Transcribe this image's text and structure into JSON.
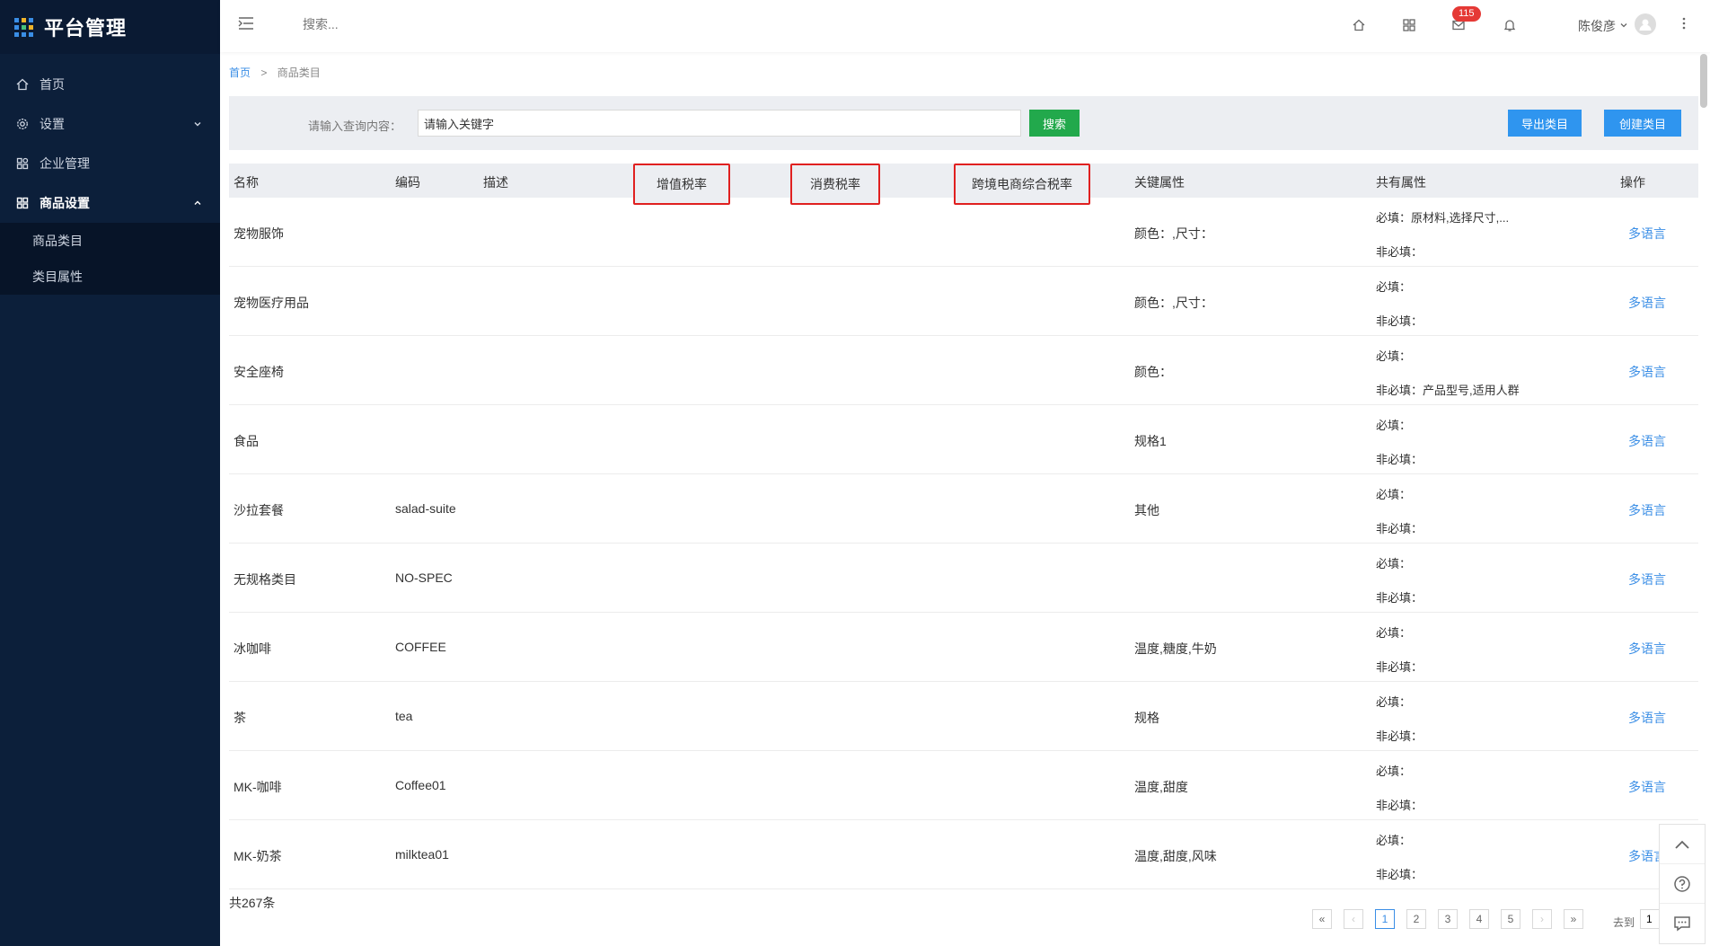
{
  "app": {
    "title": "平台管理"
  },
  "sidebar": {
    "items": [
      {
        "label": "首页",
        "icon": "home-icon"
      },
      {
        "label": "设置",
        "icon": "gear-icon"
      },
      {
        "label": "企业管理",
        "icon": "building-icon"
      },
      {
        "label": "商品设置",
        "icon": "grid-icon"
      }
    ],
    "submenu": [
      {
        "label": "商品类目"
      },
      {
        "label": "类目属性"
      }
    ]
  },
  "header": {
    "search_placeholder": "搜索...",
    "notification_count": "115",
    "user_name": "陈俊彦"
  },
  "breadcrumb": {
    "home": "首页",
    "separator": ">",
    "current": "商品类目"
  },
  "search": {
    "label": "请输入查询内容：",
    "input_value": "请输入关键字",
    "search_button": "搜索",
    "export_button": "导出类目",
    "create_button": "创建类目"
  },
  "table": {
    "headers": {
      "name": "名称",
      "code": "编码",
      "desc": "描述",
      "vat": "增值税率",
      "consumption": "消费税率",
      "crossborder": "跨境电商综合税率",
      "key_attr": "关键属性",
      "shared_attr": "共有属性",
      "action": "操作"
    },
    "rows": [
      {
        "name": "宠物服饰",
        "code": "",
        "key_attr": "颜色：,尺寸：",
        "required": "必填：原材料,选择尺寸,...",
        "optional": "非必填：",
        "action": "多语言"
      },
      {
        "name": "宠物医疗用品",
        "code": "",
        "key_attr": "颜色：,尺寸：",
        "required": "必填：",
        "optional": "非必填：",
        "action": "多语言"
      },
      {
        "name": "安全座椅",
        "code": "",
        "key_attr": "颜色：",
        "required": "必填：",
        "optional": "非必填：产品型号,适用人群",
        "action": "多语言"
      },
      {
        "name": "食品",
        "code": "",
        "key_attr": "规格1",
        "required": "必填：",
        "optional": "非必填：",
        "action": "多语言"
      },
      {
        "name": "沙拉套餐",
        "code": "salad-suite",
        "key_attr": "其他",
        "required": "必填：",
        "optional": "非必填：",
        "action": "多语言"
      },
      {
        "name": "无规格类目",
        "code": "NO-SPEC",
        "key_attr": "",
        "required": "必填：",
        "optional": "非必填：",
        "action": "多语言"
      },
      {
        "name": "冰咖啡",
        "code": "COFFEE",
        "key_attr": "温度,糖度,牛奶",
        "required": "必填：",
        "optional": "非必填：",
        "action": "多语言"
      },
      {
        "name": "茶",
        "code": "tea",
        "key_attr": "规格",
        "required": "必填：",
        "optional": "非必填：",
        "action": "多语言"
      },
      {
        "name": "MK-咖啡",
        "code": "Coffee01",
        "key_attr": "温度,甜度",
        "required": "必填：",
        "optional": "非必填：",
        "action": "多语言"
      },
      {
        "name": "MK-奶茶",
        "code": "milktea01",
        "key_attr": "温度,甜度,风味",
        "required": "必填：",
        "optional": "非必填：",
        "action": "多语言"
      }
    ]
  },
  "footer": {
    "total": "共267条",
    "pages": [
      "«",
      "‹",
      "1",
      "2",
      "3",
      "4",
      "5",
      "›",
      "»"
    ],
    "current_page": "1",
    "goto_label": "去到",
    "goto_value": "1"
  },
  "colors": {
    "sidebar_bg": "#0c1f3a",
    "accent": "#2f95ef",
    "search_green": "#22a94c",
    "highlight_red": "#e02020",
    "badge_red": "#e53935"
  }
}
